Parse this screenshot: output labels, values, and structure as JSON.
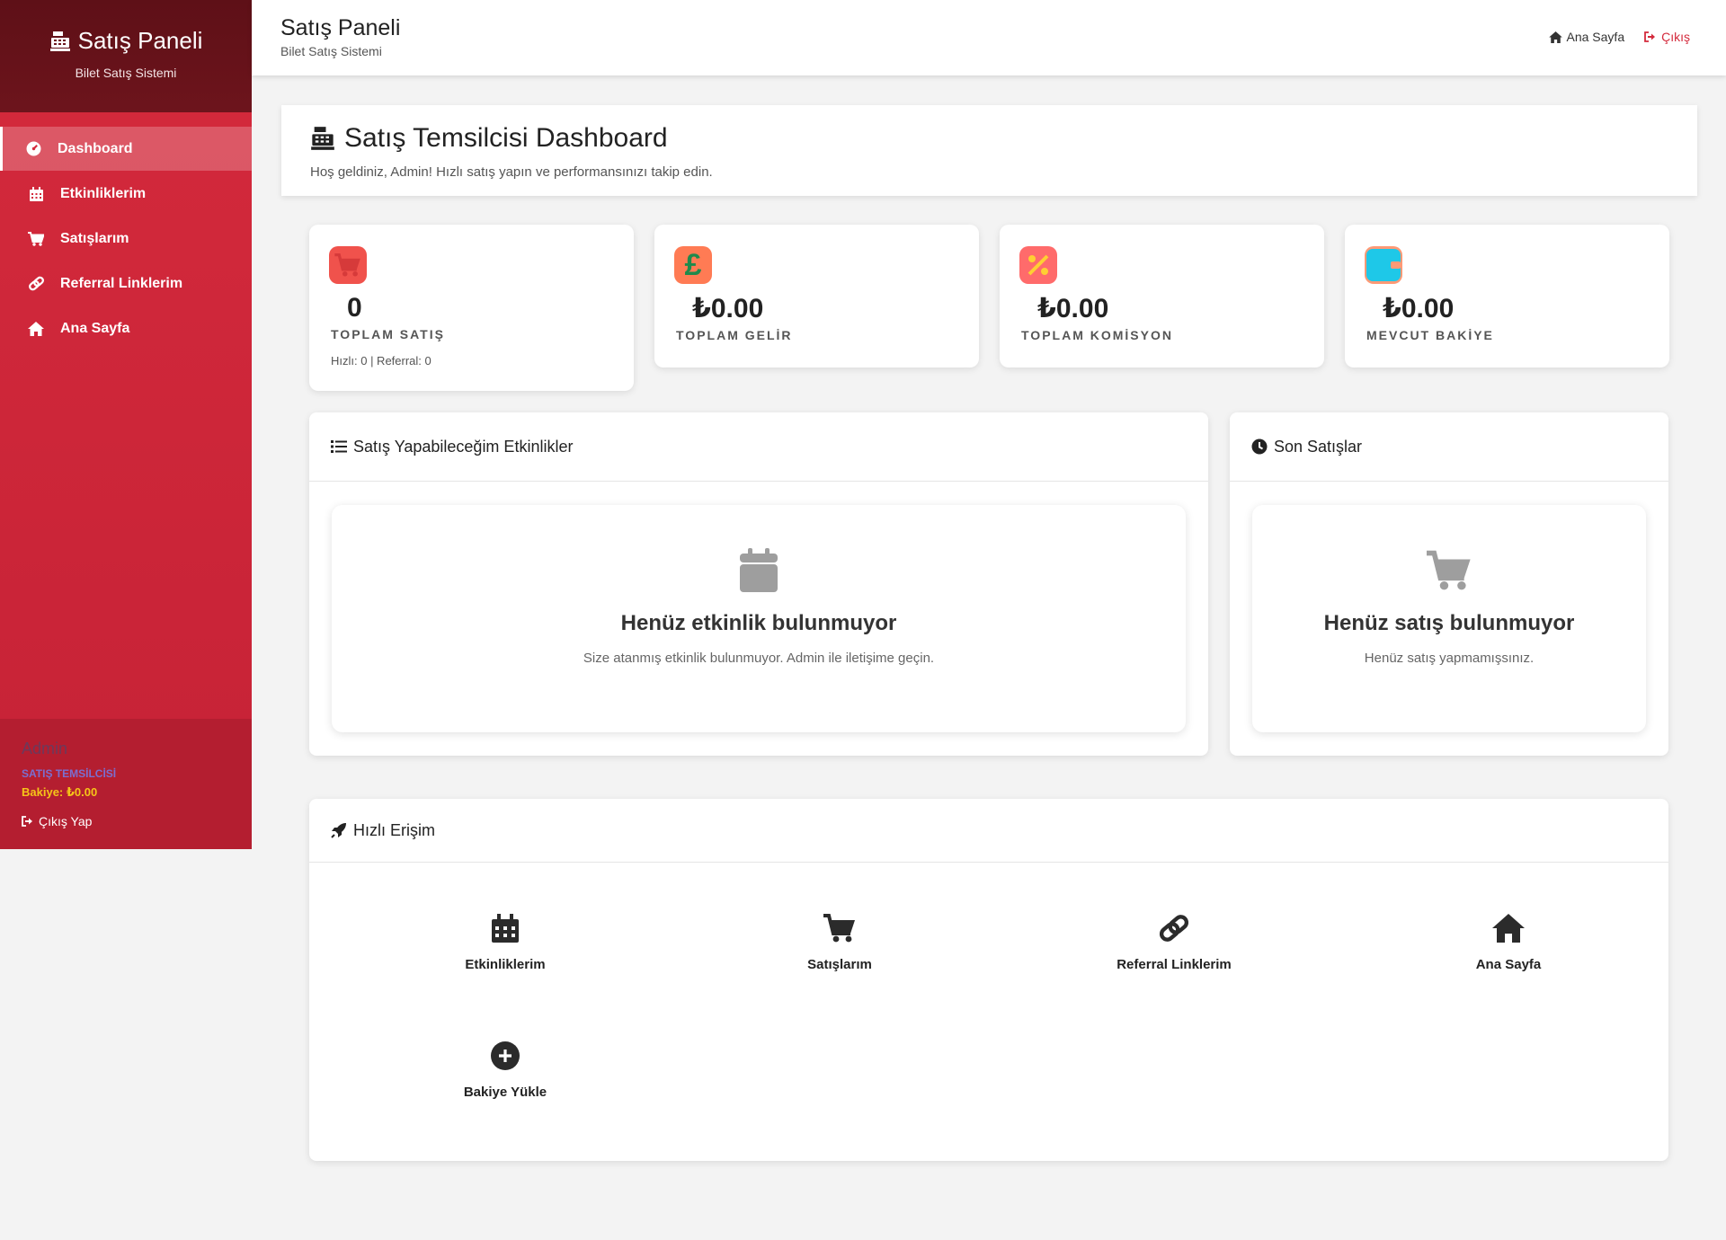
{
  "sidebar": {
    "brand_title": "Satış Paneli",
    "brand_subtitle": "Bilet Satış Sistemi",
    "items": [
      {
        "label": "Dashboard",
        "icon": "dashboard-icon"
      },
      {
        "label": "Etkinliklerim",
        "icon": "calendar-icon"
      },
      {
        "label": "Satışlarım",
        "icon": "cart-icon"
      },
      {
        "label": "Referral Linklerim",
        "icon": "link-icon"
      },
      {
        "label": "Ana Sayfa",
        "icon": "home-icon"
      }
    ],
    "user": {
      "name": "Admin",
      "role": "SATIŞ TEMSİLCİSİ",
      "balance": "Bakiye: ₺0.00",
      "logout": "Çıkış Yap"
    }
  },
  "topbar": {
    "title": "Satış Paneli",
    "subtitle": "Bilet Satış Sistemi",
    "home_link": "Ana Sayfa",
    "logout_link": "Çıkış"
  },
  "welcome": {
    "title": "Satış Temsilcisi Dashboard",
    "text": "Hoş geldiniz, Admin! Hızlı satış yapın ve performansınızı takip edin."
  },
  "stats": [
    {
      "value": "0",
      "label": "TOPLAM SATIŞ",
      "detail": "Hızlı: 0 | Referral: 0",
      "color": "#f0524c"
    },
    {
      "value": "₺0.00",
      "label": "TOPLAM GELİR",
      "color": "#ff7b54"
    },
    {
      "value": "₺0.00",
      "label": "TOPLAM KOMİSYON",
      "color": "#ff6b6b"
    },
    {
      "value": "₺0.00",
      "label": "MEVCUT BAKİYE",
      "color": "#29b6f6"
    }
  ],
  "events_panel": {
    "title": "Satış Yapabileceğim Etkinlikler",
    "empty_title": "Henüz etkinlik bulunmuyor",
    "empty_text": "Size atanmış etkinlik bulunmuyor. Admin ile iletişime geçin."
  },
  "sales_panel": {
    "title": "Son Satışlar",
    "empty_title": "Henüz satış bulunmuyor",
    "empty_text": "Henüz satış yapmamışsınız."
  },
  "quick_access": {
    "title": "Hızlı Erişim",
    "items": [
      {
        "label": "Etkinliklerim",
        "icon": "calendar-icon"
      },
      {
        "label": "Satışlarım",
        "icon": "cart-icon"
      },
      {
        "label": "Referral Linklerim",
        "icon": "link-icon"
      },
      {
        "label": "Ana Sayfa",
        "icon": "home-icon"
      },
      {
        "label": "Bakiye Yükle",
        "icon": "plus-circle-icon"
      }
    ]
  },
  "colors": {
    "sidebar": "#d42a3c",
    "brand": "#6d141c",
    "accent": "#d42a3c",
    "balance": "#f5c518"
  }
}
